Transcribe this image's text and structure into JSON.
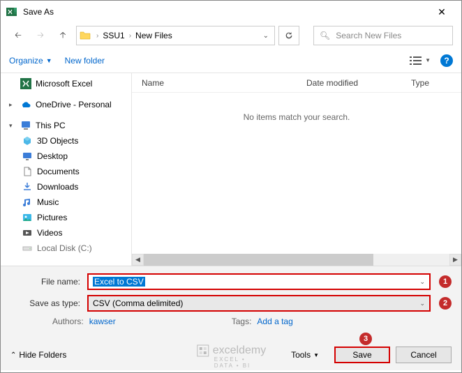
{
  "title": "Save As",
  "path": {
    "crumb1": "SSU1",
    "crumb2": "New Files"
  },
  "search": {
    "placeholder": "Search New Files"
  },
  "toolbar": {
    "organize": "Organize",
    "newfolder": "New folder"
  },
  "sidebar": {
    "excel": "Microsoft Excel",
    "onedrive": "OneDrive - Personal",
    "thispc": "This PC",
    "objects3d": "3D Objects",
    "desktop": "Desktop",
    "documents": "Documents",
    "downloads": "Downloads",
    "music": "Music",
    "pictures": "Pictures",
    "videos": "Videos",
    "localdisk": "Local Disk (C:)"
  },
  "columns": {
    "name": "Name",
    "date": "Date modified",
    "type": "Type"
  },
  "empty_msg": "No items match your search.",
  "filename_label": "File name:",
  "filename_value": "Excel to CSV",
  "savetype_label": "Save as type:",
  "savetype_value": "CSV (Comma delimited)",
  "authors_label": "Authors:",
  "authors_value": "kawser",
  "tags_label": "Tags:",
  "tags_value": "Add a tag",
  "watermark": "exceldemy",
  "watermark_sub": "EXCEL • DATA • BI",
  "hide_folders": "Hide Folders",
  "tools": "Tools",
  "save": "Save",
  "cancel": "Cancel",
  "callout1": "1",
  "callout2": "2",
  "callout3": "3"
}
